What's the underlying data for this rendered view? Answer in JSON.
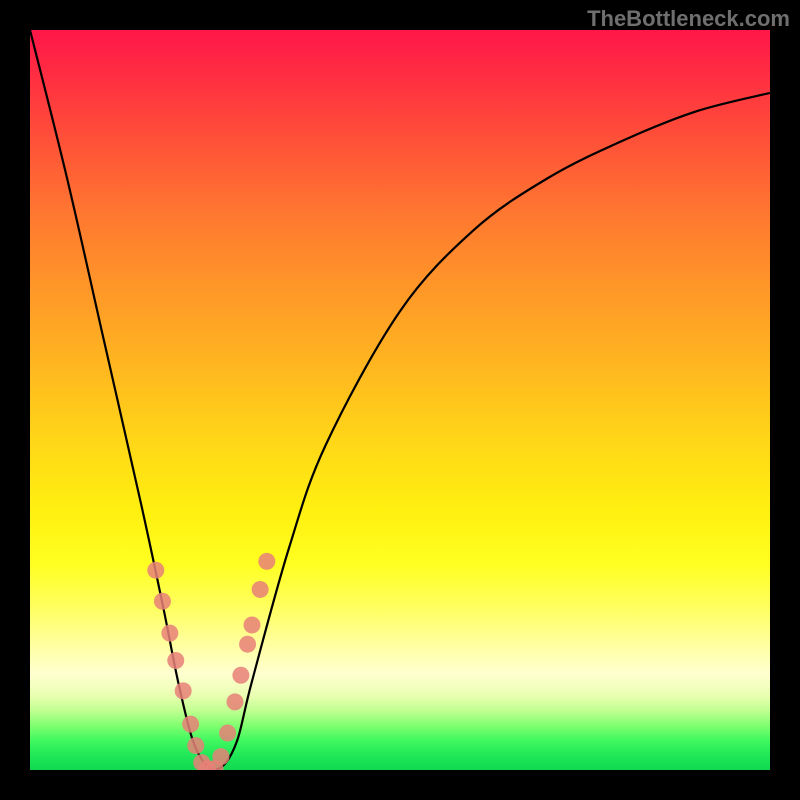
{
  "watermark": "TheBottleneck.com",
  "chart_data": {
    "type": "line",
    "title": "",
    "xlabel": "",
    "ylabel": "",
    "xlim": [
      0,
      1
    ],
    "ylim": [
      0,
      1
    ],
    "grid": false,
    "legend": false,
    "series": [
      {
        "name": "bottleneck-curve",
        "x": [
          0.0,
          0.05,
          0.1,
          0.15,
          0.18,
          0.2,
          0.22,
          0.24,
          0.26,
          0.28,
          0.3,
          0.35,
          0.4,
          0.5,
          0.6,
          0.7,
          0.8,
          0.9,
          1.0
        ],
        "y": [
          1.0,
          0.8,
          0.58,
          0.36,
          0.22,
          0.12,
          0.04,
          0.005,
          0.005,
          0.04,
          0.12,
          0.3,
          0.44,
          0.62,
          0.73,
          0.8,
          0.85,
          0.89,
          0.915
        ],
        "color": "#000000"
      }
    ],
    "markers": {
      "name": "overlap-points",
      "color": "#e88078",
      "x": [
        0.17,
        0.179,
        0.189,
        0.197,
        0.207,
        0.217,
        0.224,
        0.232,
        0.24,
        0.25,
        0.258,
        0.267,
        0.277,
        0.285,
        0.294,
        0.3,
        0.311,
        0.32
      ],
      "y": [
        0.27,
        0.228,
        0.185,
        0.148,
        0.107,
        0.062,
        0.033,
        0.01,
        0.002,
        0.002,
        0.018,
        0.05,
        0.092,
        0.128,
        0.17,
        0.196,
        0.244,
        0.282
      ]
    },
    "background_gradient": {
      "top_color": "#ff1648",
      "bottom_color": "#10d850",
      "meaning": "red (high bottleneck) to green (low bottleneck)"
    }
  }
}
